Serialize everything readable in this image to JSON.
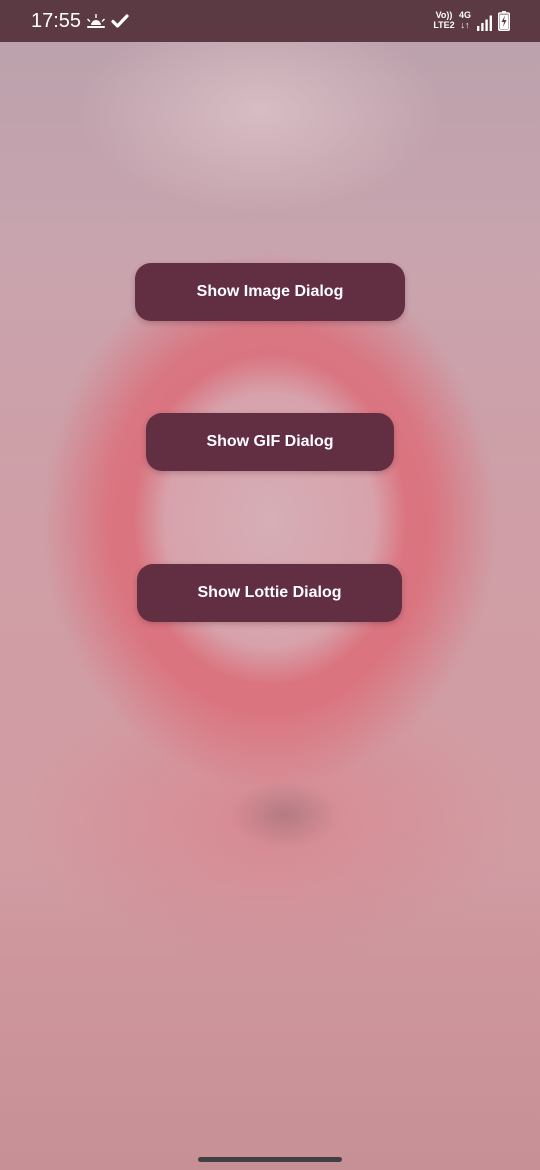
{
  "status_bar": {
    "time": "17:55",
    "weather_icon": "sun-cloud-icon",
    "check_icon": "check-icon",
    "volte_line1": "Vo))",
    "volte_line2": "LTE2",
    "network_line1": "4G",
    "network_line2": "↓↑",
    "signal_icon": "signal-icon",
    "battery_icon": "battery-charging-icon",
    "background_color": "#5b3a43"
  },
  "buttons": {
    "image_dialog_label": "Show Image Dialog",
    "gif_dialog_label": "Show GIF Dialog",
    "lottie_dialog_label": "Show Lottie Dialog",
    "button_color": "#622f42",
    "text_color": "#ffffff"
  },
  "navigation": {
    "handle": "gesture-nav-handle"
  }
}
